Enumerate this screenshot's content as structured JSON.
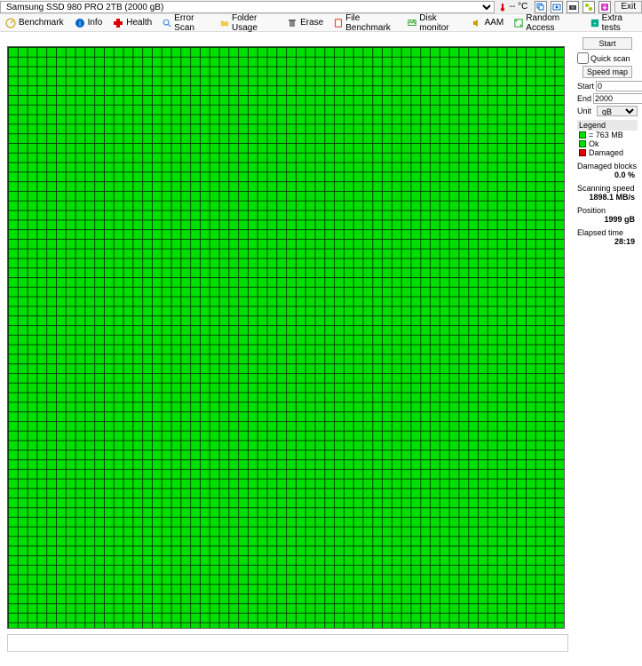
{
  "drive": "Samsung SSD 980 PRO 2TB (2000 gB)",
  "temp": "-- °C",
  "exit": "Exit",
  "toolbar": [
    {
      "label": "Benchmark"
    },
    {
      "label": "Info"
    },
    {
      "label": "Health"
    },
    {
      "label": "Error Scan"
    },
    {
      "label": "Folder Usage"
    },
    {
      "label": "Erase"
    },
    {
      "label": "File Benchmark"
    },
    {
      "label": "Disk monitor"
    },
    {
      "label": "AAM"
    },
    {
      "label": "Random Access"
    },
    {
      "label": "Extra tests"
    }
  ],
  "side": {
    "start_btn": "Start",
    "quick_scan": "Quick scan",
    "speed_map": "Speed map",
    "start_label": "Start",
    "start_val": "0",
    "end_label": "End",
    "end_val": "2000",
    "unit_label": "Unit",
    "unit_val": "gB"
  },
  "legend": {
    "title": "Legend",
    "block_size": "= 763 MB",
    "ok": "Ok",
    "damaged": "Damaged"
  },
  "stats": {
    "damaged_label": "Damaged blocks",
    "damaged_val": "0.0 %",
    "speed_label": "Scanning speed",
    "speed_val": "1898.1 MB/s",
    "pos_label": "Position",
    "pos_val": "1999 gB",
    "elapsed_label": "Elapsed time",
    "elapsed_val": "28:19"
  }
}
